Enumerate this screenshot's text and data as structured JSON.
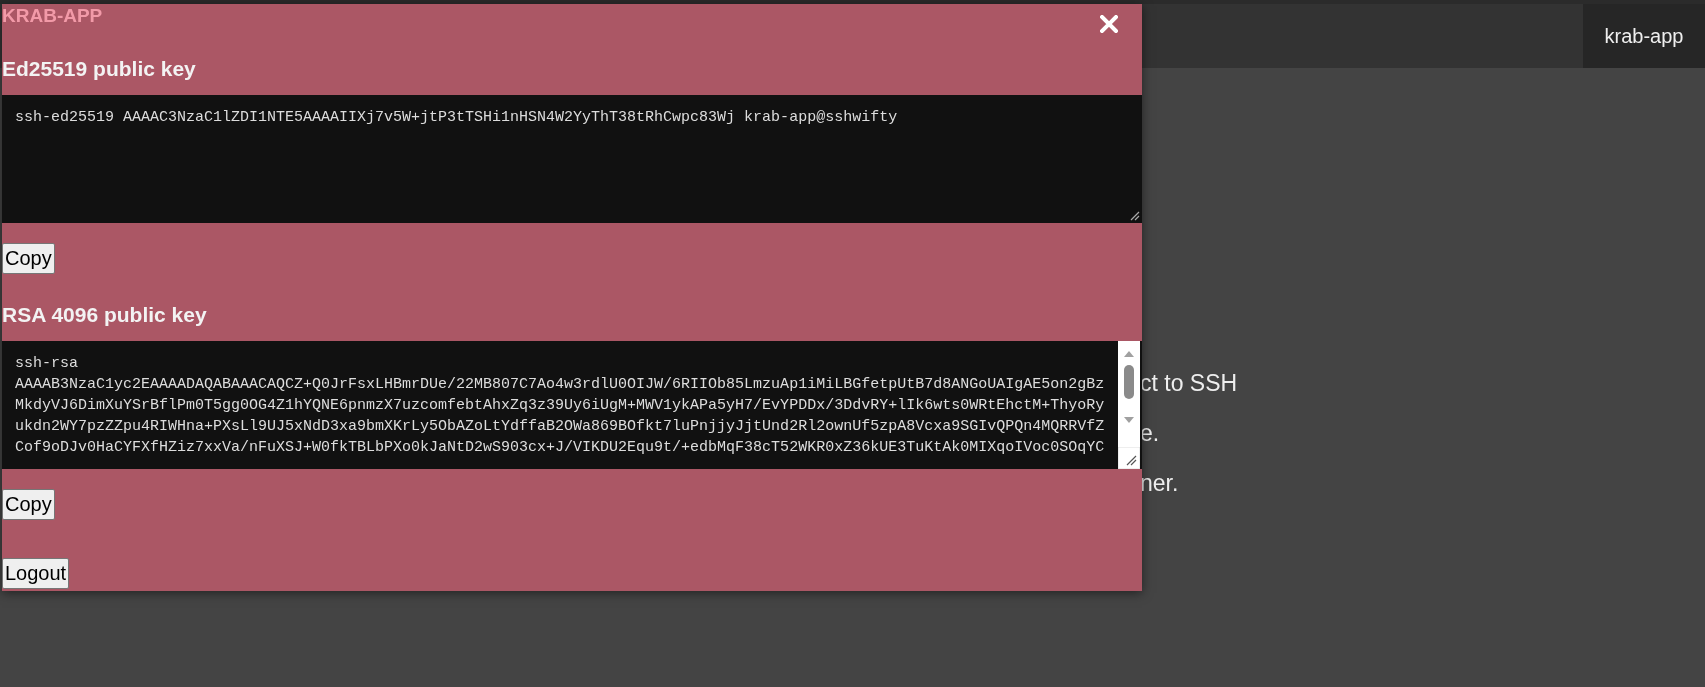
{
  "page": {
    "tab": "krab-app",
    "texts": [
      "ct to SSH",
      "e.",
      "ner."
    ]
  },
  "modal": {
    "title": "KRAB-APP",
    "sections": [
      {
        "heading": "Ed25519 public key",
        "scrollable": false,
        "button": "Copy",
        "key_lines": [
          "ssh-ed25519 AAAAC3NzaC1lZDI1NTE5AAAAIIXj7v5W+jtP3tTSHi1nHSN4W2YyThT38tRhCwpc83Wj krab-app@sshwifty"
        ]
      },
      {
        "heading": "RSA 4096 public key",
        "scrollable": true,
        "button": "Copy",
        "key_lines": [
          "ssh-rsa",
          "AAAAB3NzaC1yc2EAAAADAQABAAACAQCZ+Q0JrFsxLHBmrDUe/22MB807C7Ao4w3rdlU0OIJW/6RIIOb85LmzuAp1iMiLBGfetpUtB7d8ANGoUAIgAE5on2gBz",
          "MkdyVJ6DimXuYSrBflPm0T5gg0OG4Z1hYQNE6pnmzX7uzcomfebtAhxZq3z39Uy6iUgM+MWV1ykAPa5yH7/EvYPDDx/3DdvRY+lIk6wts0WRtEhctM+ThyoRy",
          "ukdn2WY7pzZZpu4RIWHna+PXsLl9UJ5xNdD3xa9bmXKrLy5ObAZoLtYdffaB2OWa869BOfkt7luPnjjyJjtUnd2Rl2ownUf5zpA8Vcxa9SGIvQPQn4MQRRVfZ",
          "Cof9oDJv0HaCYFXfHZiz7xxVa/nFuXSJ+W0fkTBLbPXo0kJaNtD2wS903cx+J/VIKDU2Equ9t/+edbMqF38cT52WKR0xZ36kUE3TuKtAk0MIXqoIVoc0SOqYC"
        ]
      }
    ],
    "logout": "Logout"
  }
}
